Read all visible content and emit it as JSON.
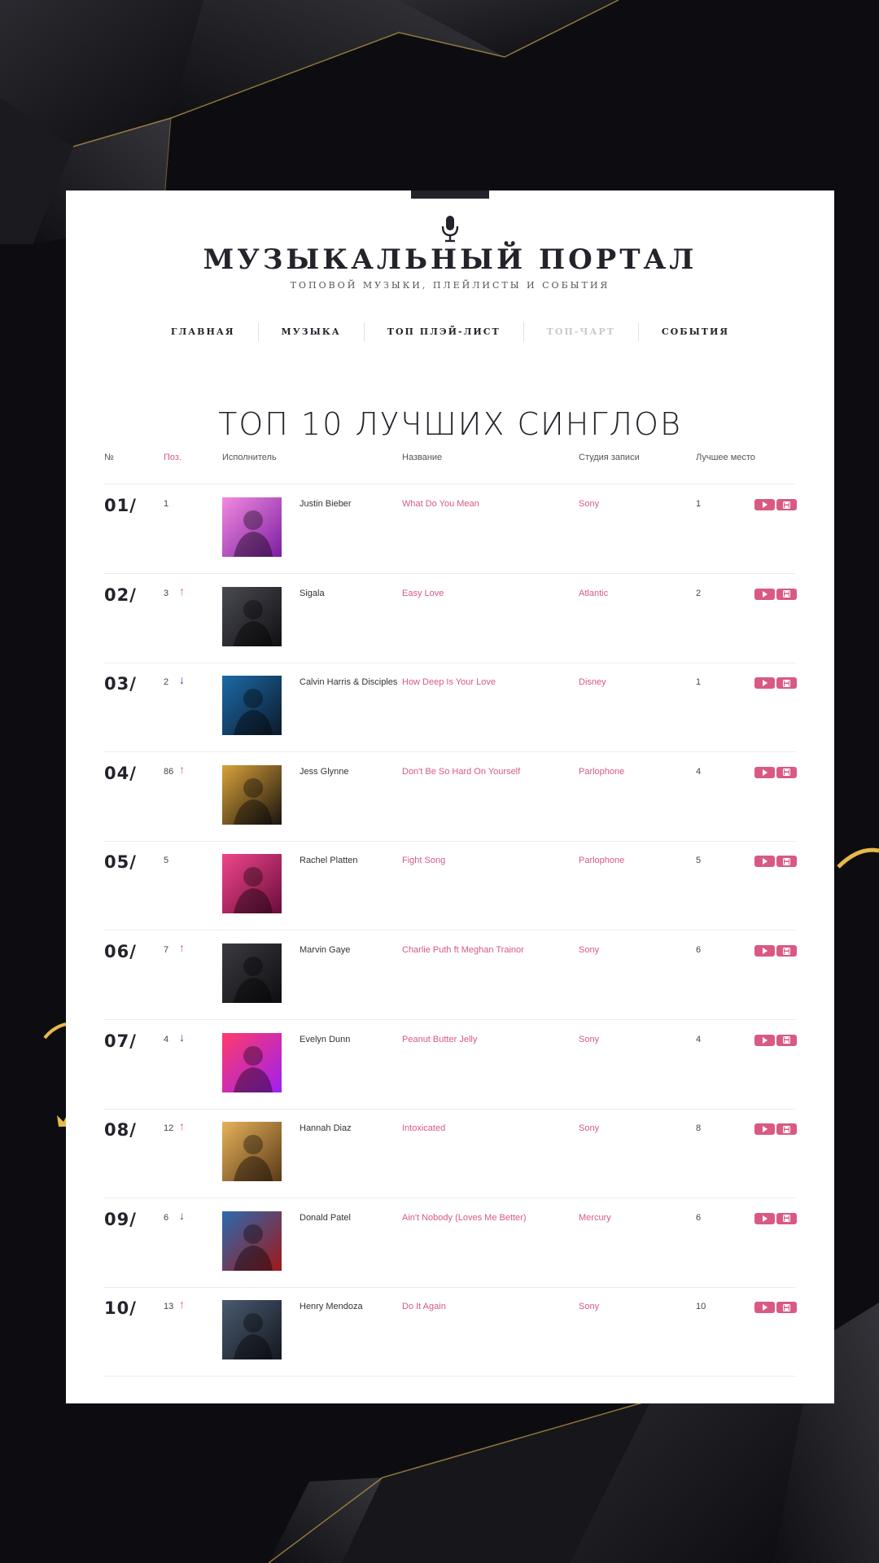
{
  "header": {
    "title": "МУЗЫКАЛЬНЫЙ ПОРТАЛ",
    "subtitle": "ТОПОВОЙ МУЗЫКИ, ПЛЕЙЛИСТЫ И СОБЫТИЯ",
    "icon": "microphone-icon"
  },
  "nav": {
    "items": [
      {
        "label": "ГЛАВНАЯ",
        "active": false
      },
      {
        "label": "МУЗЫКА",
        "active": false
      },
      {
        "label": "ТОП ПЛЭЙ-ЛИСТ",
        "active": false
      },
      {
        "label": "ТОП-ЧАРТ",
        "active": true
      },
      {
        "label": "СОБЫТИЯ",
        "active": false
      }
    ]
  },
  "page_heading": "ТОП 10 ЛУЧШИХ СИНГЛОВ",
  "table": {
    "headers": {
      "number": "№",
      "position": "Поз.",
      "artist": "Исполнитель",
      "title": "Название",
      "studio": "Студия записи",
      "best": "Лучшее место"
    },
    "rows": [
      {
        "num": "01/",
        "pos": "1",
        "trend": "",
        "artist": "Justin Bieber",
        "title": "What Do You Mean",
        "studio": "Sony",
        "best": "1"
      },
      {
        "num": "02/",
        "pos": "3",
        "trend": "up",
        "artist": "Sigala",
        "title": "Easy Love",
        "studio": "Atlantic",
        "best": "2"
      },
      {
        "num": "03/",
        "pos": "2",
        "trend": "down",
        "artist": "Calvin Harris & Disciples",
        "title": "How Deep Is Your Love",
        "studio": "Disney",
        "best": "1"
      },
      {
        "num": "04/",
        "pos": "86",
        "trend": "up",
        "artist": "Jess Glynne",
        "title": "Don't Be So Hard On Yourself",
        "studio": "Parlophone",
        "best": "4"
      },
      {
        "num": "05/",
        "pos": "5",
        "trend": "",
        "artist": "Rachel Platten",
        "title": "Fight Song",
        "studio": "Parlophone",
        "best": "5"
      },
      {
        "num": "06/",
        "pos": "7",
        "trend": "up",
        "artist": "Marvin Gaye",
        "title": "Charlie Puth ft Meghan Trainor",
        "studio": "Sony",
        "best": "6"
      },
      {
        "num": "07/",
        "pos": "4",
        "trend": "down",
        "artist": "Evelyn Dunn",
        "title": "Peanut Butter Jelly",
        "studio": "Sony",
        "best": "4"
      },
      {
        "num": "08/",
        "pos": "12",
        "trend": "up",
        "artist": "Hannah Diaz",
        "title": "Intoxicated",
        "studio": "Sony",
        "best": "8"
      },
      {
        "num": "09/",
        "pos": "6",
        "trend": "down",
        "artist": "Donald Patel",
        "title": "Ain't Nobody (Loves Me Better)",
        "studio": "Mercury",
        "best": "6"
      },
      {
        "num": "10/",
        "pos": "13",
        "trend": "up",
        "artist": "Henry Mendoza",
        "title": "Do It Again",
        "studio": "Sony",
        "best": "10"
      }
    ]
  },
  "icons": {
    "trend_up": "arrow-up-icon",
    "trend_down": "arrow-down-icon",
    "play": "play-icon",
    "save": "save-icon"
  },
  "colors": {
    "accent": "#d85a82",
    "trend_down": "#3a44a8",
    "dark": "#23232b",
    "background": "#0e0e12",
    "gold": "#e8b84a"
  }
}
